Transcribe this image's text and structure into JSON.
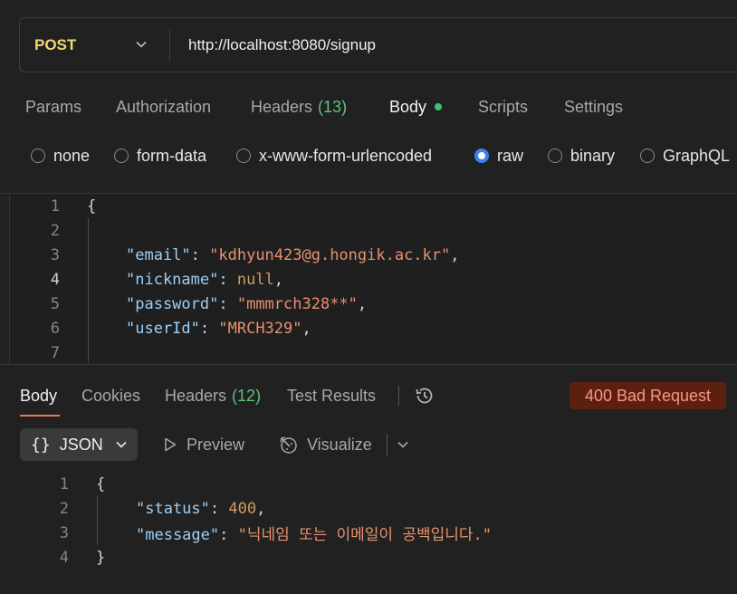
{
  "request": {
    "method": "POST",
    "url": "http://localhost:8080/signup"
  },
  "request_tabs": [
    {
      "label": "Params"
    },
    {
      "label": "Authorization"
    },
    {
      "label": "Headers",
      "count": "(13)"
    },
    {
      "label": "Body",
      "active": true
    },
    {
      "label": "Scripts"
    },
    {
      "label": "Settings"
    }
  ],
  "body_modes": [
    {
      "label": "none",
      "selected": false
    },
    {
      "label": "form-data",
      "selected": false
    },
    {
      "label": "x-www-form-urlencoded",
      "selected": false
    },
    {
      "label": "raw",
      "selected": true
    },
    {
      "label": "binary",
      "selected": false
    },
    {
      "label": "GraphQL",
      "selected": false
    }
  ],
  "editor": {
    "lines": [
      {
        "n": "1",
        "brace": "{"
      },
      {
        "n": "2"
      },
      {
        "n": "3",
        "key": "\"email\"",
        "value": "\"kdhyun423@g.hongik.ac.kr\"",
        "trail": ","
      },
      {
        "n": "4",
        "key": "\"nickname\"",
        "value": "null",
        "trail": ","
      },
      {
        "n": "5",
        "key": "\"password\"",
        "value": "\"mmmrch328**\"",
        "trail": ","
      },
      {
        "n": "6",
        "key": "\"userId\"",
        "value": "\"MRCH329\"",
        "trail": ","
      },
      {
        "n": "7"
      }
    ]
  },
  "response_tabs": [
    {
      "label": "Body",
      "active": true
    },
    {
      "label": "Cookies"
    },
    {
      "label": "Headers",
      "count": "(12)"
    },
    {
      "label": "Test Results"
    }
  ],
  "status": {
    "text": "400 Bad Request",
    "color": "#f39a82",
    "bg": "#5c1f12"
  },
  "response_toolbar": {
    "format_braces": "{}",
    "format": "JSON",
    "preview": "Preview",
    "visualize": "Visualize"
  },
  "response_body": {
    "lines": [
      {
        "n": "1",
        "brace": "{"
      },
      {
        "n": "2",
        "key": "\"status\"",
        "value": "400",
        "trail": ","
      },
      {
        "n": "3",
        "key": "\"message\"",
        "value": "\"닉네임 또는 이메일이 공백입니다.\""
      },
      {
        "n": "4",
        "brace": "}"
      }
    ]
  },
  "colors": {
    "accent": "#e67a50",
    "radio_selected": "#3e7ff6",
    "count_green": "#5ec27a",
    "method": "#f5d76e"
  }
}
